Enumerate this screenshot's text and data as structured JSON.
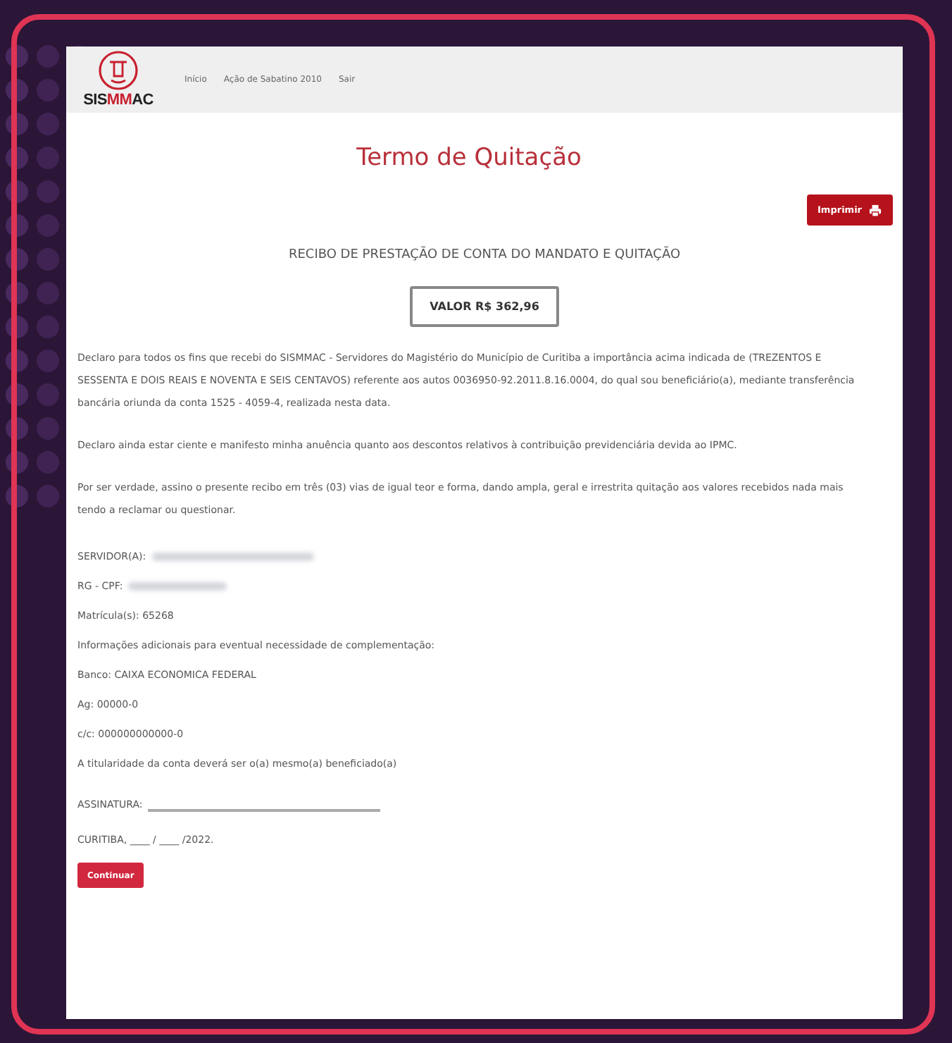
{
  "logo": {
    "parts": [
      {
        "text": "SIS",
        "accent": false
      },
      {
        "text": "MM",
        "accent": true
      },
      {
        "text": "AC",
        "accent": false
      }
    ]
  },
  "nav": [
    "Início",
    "Ação de Sabatino 2010",
    "Sair"
  ],
  "title": "Termo de Quitação",
  "print_button": "Imprimir",
  "heading": "RECIBO DE PRESTAÇÃO DE CONTA DO MANDATO E QUITAÇÃO",
  "amount": "VALOR R$ 362,96",
  "paragraphs": [
    "Declaro para todos os fins que recebi do SISMMAC - Servidores do Magistério do Município de Curitiba a importância acima indicada de (TREZENTOS E SESSENTA E DOIS REAIS E NOVENTA E SEIS CENTAVOS) referente aos autos 0036950-92.2011.8.16.0004, do qual sou beneficiário(a), mediante transferência bancária oriunda da conta 1525 - 4059-4, realizada nesta data.",
    "Declaro ainda estar ciente e manifesto minha anuência quanto aos descontos relativos à contribuição previdenciária devida ao IPMC.",
    "Por ser verdade, assino o presente recibo em três (03) vias de igual teor e forma, dando ampla, geral e irrestrita quitação aos valores recebidos nada mais tendo a reclamar ou questionar."
  ],
  "details": [
    {
      "kind": "redacted",
      "text": "SERVIDOR(A):"
    },
    {
      "kind": "redacted",
      "text": "RG - CPF:"
    },
    {
      "kind": "plain",
      "text": "Matrícula(s): 65268"
    },
    {
      "kind": "plain",
      "text": "Informações adicionais para eventual necessidade de complementação:"
    },
    {
      "kind": "plain",
      "text": "Banco: CAIXA ECONOMICA FEDERAL"
    },
    {
      "kind": "plain",
      "text": "Ag: 00000-0"
    },
    {
      "kind": "plain",
      "text": "c/c: 000000000000-0"
    },
    {
      "kind": "plain",
      "text": "A titularidade da conta deverá ser o(a) mesmo(a) beneficiado(a)"
    }
  ],
  "signature_label": "ASSINATURA:",
  "date_line": "CURITIBA, ____ / ____ /2022.",
  "continue_button": "Continuar"
}
